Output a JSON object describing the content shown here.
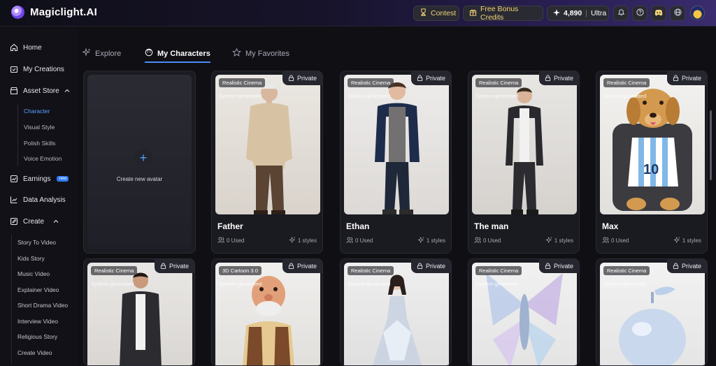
{
  "app": {
    "name": "Magiclight.AI"
  },
  "topbar": {
    "contest_label": "Contest",
    "bonus_label": "Free Bonus Credits",
    "credits": "4,890",
    "separator": "|",
    "plan": "Ultra",
    "icons": [
      "bell-icon",
      "help-icon",
      "discord-icon",
      "globe-icon"
    ]
  },
  "sidebar": {
    "home": "Home",
    "my_creations": "My Creations",
    "asset_store": "Asset Store",
    "asset_sub": [
      "Character",
      "Visual Style",
      "Polish Skills",
      "Voice Emotion"
    ],
    "earnings": "Earnings",
    "earnings_badge": "new",
    "data_analysis": "Data Analysis",
    "create": "Create",
    "create_sub": [
      "Story To Video",
      "Kids Story",
      "Music Video",
      "Explainer Video",
      "Short Drama Video",
      "Interview Video",
      "Religious Story",
      "Create Video"
    ]
  },
  "tabs": {
    "explore": "Explore",
    "my_characters": "My Characters",
    "my_favorites": "My Favorites"
  },
  "new_avatar_label": "Create new avatar",
  "private_label": "Private",
  "system_label": "System-generated",
  "cards_row1": [
    {
      "tag": "Realistic Cinema",
      "name": "Father",
      "used": "0 Used",
      "styles": "1 styles"
    },
    {
      "tag": "Realistic Cinema",
      "name": "Ethan",
      "used": "0 Used",
      "styles": "1 styles"
    },
    {
      "tag": "Realistic Cinema",
      "name": "The man",
      "used": "0 Used",
      "styles": "1 styles"
    },
    {
      "tag": "Realistic Cinema",
      "name": "Max",
      "used": "0 Used",
      "styles": "1 styles"
    }
  ],
  "cards_row2": [
    {
      "tag": "Realistic Cinema"
    },
    {
      "tag": "3D Cartoon 3.0"
    },
    {
      "tag": "Realistic Cinema"
    },
    {
      "tag": "Realistic Cinema"
    },
    {
      "tag": "Realistic Cinema"
    }
  ],
  "colors": {
    "accent": "#4d8cf5",
    "gold": "#f1d37a",
    "background": "#0f0f14"
  }
}
